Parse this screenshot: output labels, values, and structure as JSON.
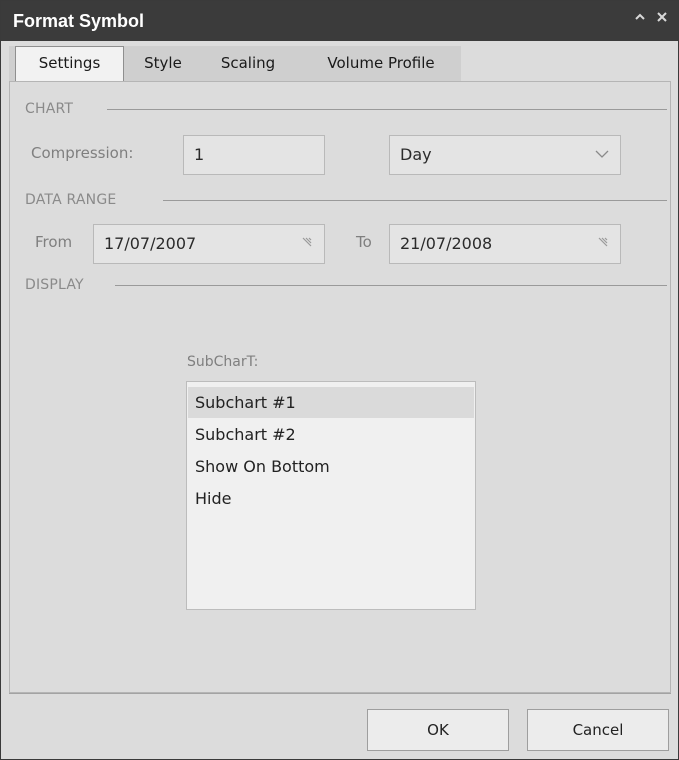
{
  "window": {
    "title": "Format Symbol",
    "collapse_icon": "chevron-up-icon",
    "close_icon": "close-icon"
  },
  "tabs": [
    {
      "label": "Settings",
      "active": true
    },
    {
      "label": "Style",
      "active": false
    },
    {
      "label": "Scaling",
      "active": false
    },
    {
      "label": "Volume Profile",
      "active": false
    }
  ],
  "chart_section": {
    "heading": "CHART",
    "compression_label": "Compression:",
    "compression_value": "1",
    "period_value": "Day",
    "period_icon": "chevron-down-icon"
  },
  "data_range_section": {
    "heading": "DATA RANGE",
    "from_label": "From",
    "from_value": "17/07/2007",
    "to_label": "To",
    "to_value": "21/07/2008",
    "date_icon": "calendar-picker-icon"
  },
  "display_section": {
    "heading": "DISPLAY",
    "subchart_label": "SubCharT:",
    "subchart_options": [
      "Subchart #1",
      "Subchart #2",
      "Show On Bottom",
      "Hide"
    ],
    "selected_option": "Subchart #1"
  },
  "buttons": {
    "ok": "OK",
    "cancel": "Cancel"
  },
  "colors": {
    "titlebar": "#3b3b3b",
    "dialog_bg": "#dcdcdc",
    "selection": "#dadada"
  }
}
